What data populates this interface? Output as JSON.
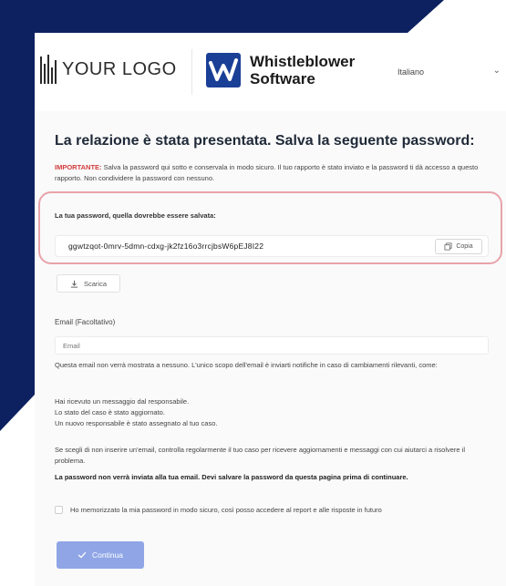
{
  "colors": {
    "navy": "#0d2160",
    "highlight_border": "#e8a3aa",
    "important_red": "#d23b3b",
    "continue_button": "#8fa5e6"
  },
  "header": {
    "your_logo_text": "YOUR LOGO",
    "brand_name_line1": "Whistleblower",
    "brand_name_line2": "Software",
    "brand_icon": "whistleblower-logo-icon",
    "language_selected": "Italiano"
  },
  "main": {
    "title": "La relazione è stata presentata. Salva la seguente password:",
    "important_label": "IMPORTANTE:",
    "important_text": " Salva la password qui sotto e conservala in modo sicuro. Il tuo rapporto è stato inviato e la password ti dà accesso a questo rapporto. Non condividere la password con nessuno.",
    "password_label": "La tua password, quella dovrebbe essere salvata:",
    "password_value": "ggwtzqot-0mrv-5dmn-cdxg-jk2fz16o3rrcjbsW6pEJ8I22",
    "copy_label": "Copia",
    "download_label": "Scarica",
    "email_label": "Email (Facoltativo)",
    "email_placeholder": "Email",
    "email_info": "Questa email non verrà mostrata a nessuno. L'unico scopo dell'email è inviarti notifiche in caso di cambiamenti rilevanti, come:",
    "notify_items": [
      "Hai ricevuto un messaggio dal responsabile.",
      "Lo stato del caso è stato aggiornato.",
      "Un nuovo responsabile è stato assegnato al tuo caso."
    ],
    "no_email_text": "Se scegli di non inserire un'email, controlla regolarmente il tuo caso per ricevere aggiornamenti e messaggi con cui aiutarci a risolvere il problema.",
    "warning_text": "La password non verrà inviata alla tua email. Devi salvare la password da questa pagina prima di continuare.",
    "confirm_checkbox_label": "Ho memorizzato la mia password in modo sicuro, così posso accedere al report e alle risposte in futuro",
    "confirm_checked": false,
    "continue_label": "Continua"
  }
}
